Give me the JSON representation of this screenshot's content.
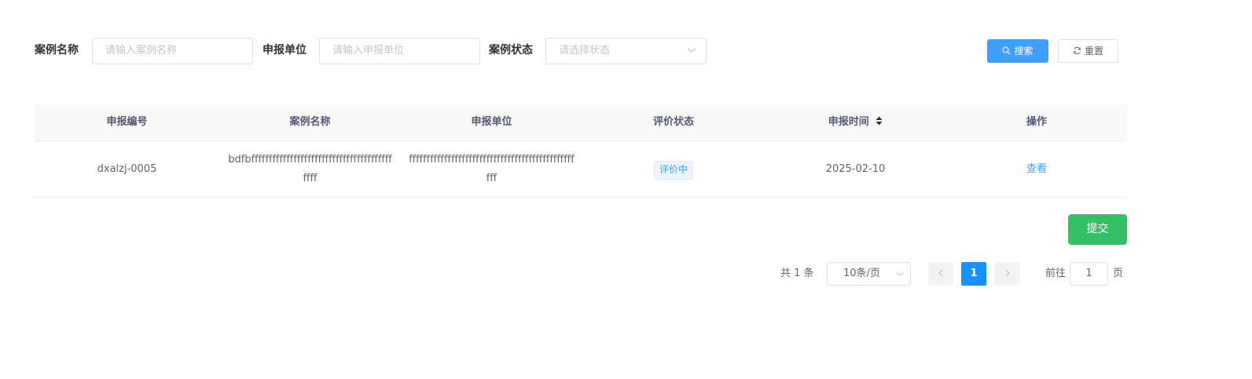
{
  "filters": {
    "case_name_label": "案例名称",
    "case_name_placeholder": "请输入案例名称",
    "unit_label": "申报单位",
    "unit_placeholder": "请输入申报单位",
    "status_label": "案例状态",
    "status_placeholder": "请选择状态",
    "search_button": "搜索",
    "reset_button": "重置"
  },
  "table": {
    "columns": [
      "申报编号",
      "案例名称",
      "申报单位",
      "评价状态",
      "申报时间",
      "操作"
    ],
    "rows": [
      {
        "code": "dxalzj-0005",
        "name": "bdfbffffffffffffffffffffffffffffffffffffffffffff",
        "unit": "ffffffffffffffffffffffffffffffffffffffffffffffffff",
        "status": "评价中",
        "date": "2025-02-10",
        "action": "查看"
      }
    ]
  },
  "submit_button": "提交",
  "pagination": {
    "total": "共 1 条",
    "page_size": "10条/页",
    "current_page": "1",
    "goto_label": "前往",
    "goto_value": "1",
    "page_suffix": "页"
  },
  "colors": {
    "primary": "#409eff",
    "success": "#35c065",
    "pager_active": "#1890ff"
  }
}
